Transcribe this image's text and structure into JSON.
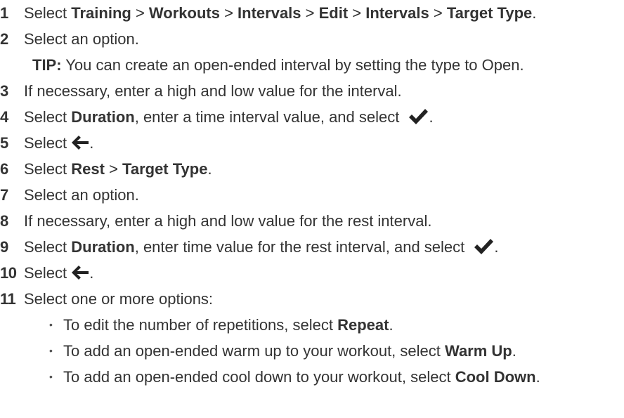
{
  "steps": [
    {
      "num": "1",
      "parts": [
        {
          "t": "Select "
        },
        {
          "t": "Training",
          "b": true
        },
        {
          "t": " > "
        },
        {
          "t": "Workouts",
          "b": true
        },
        {
          "t": " > "
        },
        {
          "t": "Intervals",
          "b": true
        },
        {
          "t": " > "
        },
        {
          "t": "Edit",
          "b": true
        },
        {
          "t": " > "
        },
        {
          "t": "Intervals",
          "b": true
        },
        {
          "t": " > "
        },
        {
          "t": "Target Type",
          "b": true
        },
        {
          "t": "."
        }
      ]
    },
    {
      "num": "2",
      "parts": [
        {
          "t": "Select an option."
        }
      ]
    },
    {
      "num": "3",
      "parts": [
        {
          "t": "If necessary, enter a high and low value for the interval."
        }
      ]
    },
    {
      "num": "4",
      "parts": [
        {
          "t": "Select "
        },
        {
          "t": "Duration",
          "b": true
        },
        {
          "t": ", enter a time interval value, and select "
        }
      ],
      "icon": "checkmark-icon",
      "after": "."
    },
    {
      "num": "5",
      "parts": [
        {
          "t": "Select "
        }
      ],
      "icon": "back-arrow-icon",
      "after": "."
    },
    {
      "num": "6",
      "parts": [
        {
          "t": "Select "
        },
        {
          "t": "Rest",
          "b": true
        },
        {
          "t": " > "
        },
        {
          "t": "Target Type",
          "b": true
        },
        {
          "t": "."
        }
      ]
    },
    {
      "num": "7",
      "parts": [
        {
          "t": "Select an option."
        }
      ]
    },
    {
      "num": "8",
      "parts": [
        {
          "t": "If necessary, enter a high and low value for the rest interval."
        }
      ]
    },
    {
      "num": "9",
      "parts": [
        {
          "t": "Select "
        },
        {
          "t": "Duration",
          "b": true
        },
        {
          "t": ", enter time value for the rest interval, and select "
        }
      ],
      "icon": "checkmark-icon",
      "after": "."
    },
    {
      "num": "10",
      "parts": [
        {
          "t": "Select "
        }
      ],
      "icon": "back-arrow-icon",
      "after": "."
    },
    {
      "num": "11",
      "parts": [
        {
          "t": "Select one or more options:"
        }
      ]
    }
  ],
  "tip": {
    "label": "TIP:",
    "text": " You can create an open-ended interval by setting the type to Open."
  },
  "bullets": [
    {
      "parts": [
        {
          "t": "To edit the number of repetitions, select "
        },
        {
          "t": "Repeat",
          "b": true
        },
        {
          "t": "."
        }
      ]
    },
    {
      "parts": [
        {
          "t": "To add an open-ended warm up to your workout, select "
        },
        {
          "t": "Warm Up",
          "b": true
        },
        {
          "t": "."
        }
      ]
    },
    {
      "parts": [
        {
          "t": "To add an open-ended cool down to your workout, select "
        },
        {
          "t": "Cool Down",
          "b": true
        },
        {
          "t": "."
        }
      ]
    }
  ],
  "bullet_glyph": "•",
  "colors": {
    "text": "#333333",
    "icon": "#222222"
  }
}
